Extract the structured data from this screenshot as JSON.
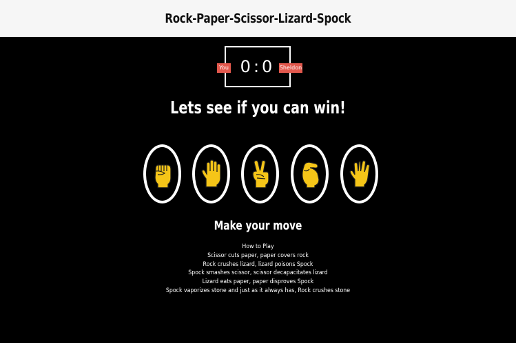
{
  "header": {
    "title": "Rock-Paper-Scissor-Lizard-Spock"
  },
  "score": {
    "user_label": "You",
    "user_score": "0",
    "separator": ":",
    "computer_label": "Sheldon",
    "computer_score": "0"
  },
  "result": {
    "message": "Lets see if you can win!"
  },
  "choices": [
    {
      "name": "rock",
      "icon": "rock-fist-icon"
    },
    {
      "name": "paper",
      "icon": "paper-hand-icon"
    },
    {
      "name": "scissor",
      "icon": "scissors-hand-icon"
    },
    {
      "name": "lizard",
      "icon": "lizard-hand-icon"
    },
    {
      "name": "spock",
      "icon": "spock-hand-icon"
    }
  ],
  "prompt": "Make your move",
  "rules": {
    "title": "How to Play",
    "lines": [
      "Scissor cuts paper, paper covers rock",
      "Rock crushes lizard, lizard poisons Spock",
      "Spock smashes scissor, scissor decapacitates lizard",
      "Lizard eats paper, paper disproves Spock",
      "Spock vaporizes stone and just as it always has, Rock crushes stone"
    ]
  },
  "colors": {
    "accent": "#e2584d",
    "hand_fill": "#f5c518",
    "background": "#000000",
    "header_bg": "#f6f6f6"
  }
}
